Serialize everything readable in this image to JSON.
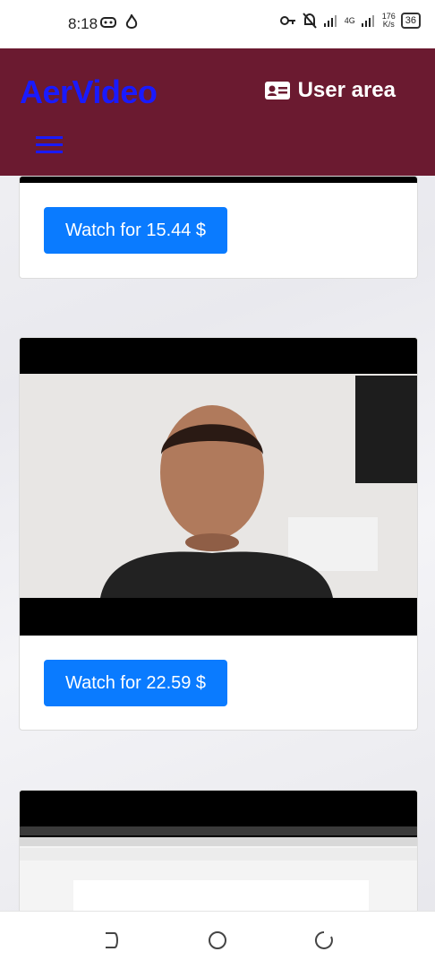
{
  "status_bar": {
    "time": "8:18",
    "net_speed_value": "176",
    "net_speed_unit": "K/s",
    "network_type": "4G",
    "battery": "36"
  },
  "header": {
    "brand": "AerVideo",
    "user_area_label": "User area",
    "accent_color": "#6b1a30",
    "brand_color": "#1a1aff"
  },
  "videos": [
    {
      "watch_label": "Watch for 15.44 $"
    },
    {
      "watch_label": "Watch for 22.59 $"
    },
    {
      "watch_label": ""
    }
  ],
  "icons": [
    "gamepad-icon",
    "flame-icon",
    "key-icon",
    "mute-bell-icon",
    "signal-icon",
    "battery-icon",
    "id-card-icon",
    "hamburger-menu-icon",
    "back-icon",
    "home-icon",
    "recents-icon"
  ],
  "button_color": "#0a7bff"
}
